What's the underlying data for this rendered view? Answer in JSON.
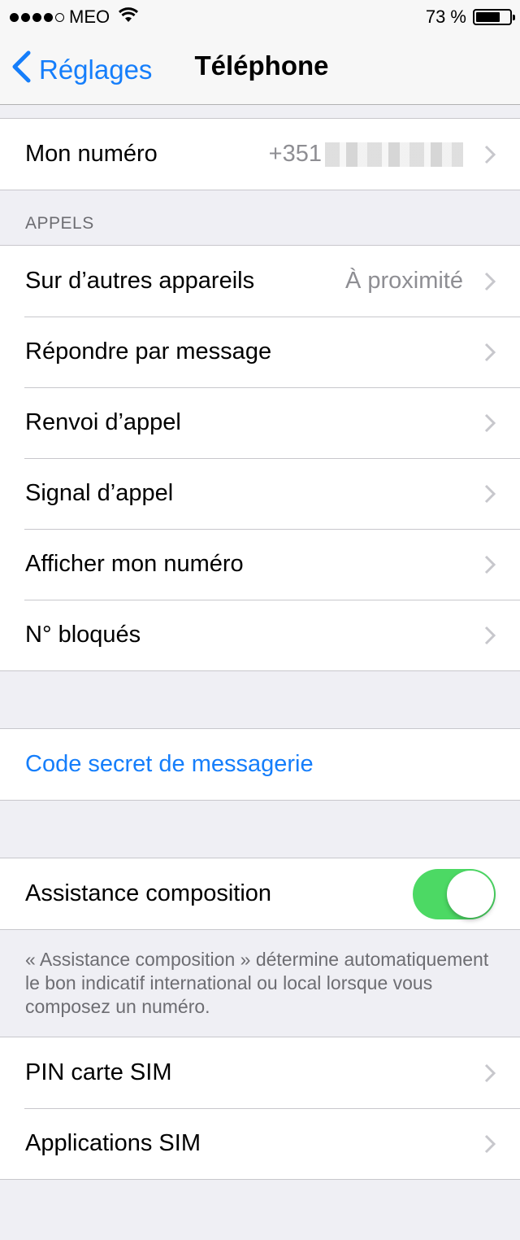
{
  "status_bar": {
    "carrier": "MEO",
    "battery_text": "73 %",
    "battery_level": 0.73,
    "signal_bars": 4,
    "signal_max": 5
  },
  "nav": {
    "back_label": "Réglages",
    "title": "Téléphone"
  },
  "my_number": {
    "label": "Mon numéro",
    "value": "+351"
  },
  "calls_section": {
    "header": "APPELS",
    "rows": [
      {
        "label": "Sur d’autres appareils",
        "value": "À proximité"
      },
      {
        "label": "Répondre par message",
        "value": ""
      },
      {
        "label": "Renvoi d’appel",
        "value": ""
      },
      {
        "label": "Signal d’appel",
        "value": ""
      },
      {
        "label": "Afficher mon numéro",
        "value": ""
      },
      {
        "label": "N° bloqués",
        "value": ""
      }
    ]
  },
  "voicemail": {
    "label": "Code secret de messagerie"
  },
  "dial_assist": {
    "label": "Assistance composition",
    "enabled": true,
    "footer": "« Assistance composition » détermine automatiquement le bon indicatif international ou local lorsque vous composez un numéro."
  },
  "sim_section": {
    "rows": [
      {
        "label": "PIN carte SIM"
      },
      {
        "label": "Applications SIM"
      }
    ]
  },
  "colors": {
    "accent": "#157efb",
    "toggle_on": "#4cd964",
    "background": "#efeff4",
    "secondary_text": "#8e8e93"
  }
}
